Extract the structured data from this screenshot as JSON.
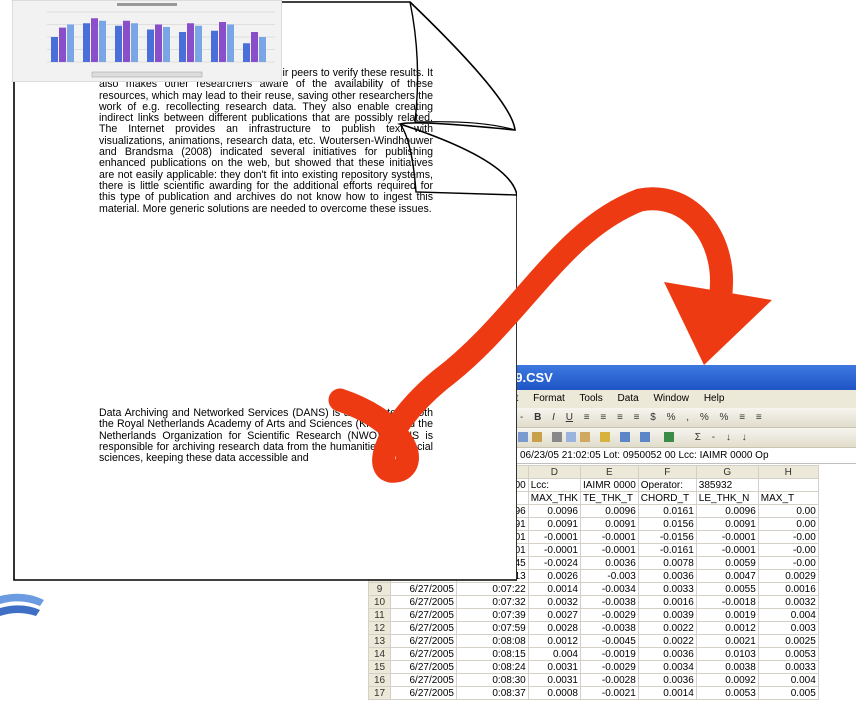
{
  "document": {
    "paragraph1": "demonstrate their results and helps their peers to verify these results. It also makes other researchers aware of the availability of these resources, which may lead to their reuse, saving other researchers the work of e.g. recollecting research data. They also enable creating indirect links between different publications that are possibly related. The Internet provides an infrastructure to publish text with visualizations, animations, research data, etc. Woutersen-Windhouwer and Brandsma (2008) indicated several initiatives for publishing enhanced publications on the web, but showed that these initiatives are not easily applicable: they don't fit into existing repository systems, there is little scientific awarding for the additional efforts required for this type of publication and archives do not know how to ingest this material. More generic solutions are needed to overcome these issues.",
    "paragraph2": "Data Archiving and Networked Services (DANS) is an institute of both the Royal Netherlands Academy of Arts and Sciences (KNAW) and the Netherlands Organization for Scientific Research (NWO). DANS is responsible for archiving research data from the humanities and social sciences, keeping these data accessible and"
  },
  "embedded_chart": {
    "type": "bar",
    "series_colors": [
      "#4a6fd8",
      "#8a4fc8",
      "#7aa6e8"
    ],
    "values": [
      [
        40,
        62,
        58,
        52,
        48,
        50,
        30
      ],
      [
        55,
        70,
        66,
        60,
        62,
        64,
        48
      ],
      [
        60,
        66,
        62,
        56,
        58,
        60,
        40
      ]
    ],
    "ymax": 80
  },
  "spreadsheet": {
    "title": "09.CSV",
    "menu": [
      "et",
      "Format",
      "Tools",
      "Data",
      "Window",
      "Help"
    ],
    "toolbar1": [
      "-",
      "B",
      "I",
      "U",
      "≡",
      "≡",
      "≡",
      "≡",
      "$",
      "%",
      ",",
      "%",
      "%",
      "≡",
      "≡"
    ],
    "toolbar2": [
      "Σ",
      "-",
      "↓",
      "↓"
    ],
    "formula_bar": "06/23/05   21:02:05   Lot: 0950052 00  Lcc: IAIMR 0000  Op",
    "col_headers": [
      "",
      "",
      "C",
      "D",
      "E",
      "F",
      "G",
      "H"
    ],
    "header_row1": [
      "",
      "",
      "ot: 0950052 00",
      "Lcc:",
      "IAIMR 0000",
      "Operator:",
      "385932",
      ""
    ],
    "header_row2": [
      "",
      "",
      "LE_THK_T",
      "MAX_THK",
      "TE_THK_T",
      "CHORD_T",
      "LE_THK_N",
      "MAX_T"
    ],
    "rows": [
      [
        "",
        "",
        "0.0096",
        "0.0096",
        "0.0096",
        "0.0161",
        "0.0096",
        "0.00"
      ],
      [
        "",
        "",
        "0.0091",
        "0.0091",
        "0.0091",
        "0.0156",
        "0.0091",
        "0.00"
      ],
      [
        "",
        "",
        "-0.0001",
        "-0.0001",
        "-0.0001",
        "-0.0156",
        "-0.0001",
        "-0.00"
      ],
      [
        "",
        "",
        "-0.0001",
        "-0.0001",
        "-0.0001",
        "-0.0161",
        "-0.0001",
        "-0.00"
      ],
      [
        "",
        "",
        "0.0045",
        "-0.0024",
        "0.0036",
        "0.0078",
        "0.0059",
        "-0.00"
      ],
      [
        "8",
        "6/27/2005",
        "0:07:13",
        "0.0026",
        "-0.003",
        "0.0036",
        "0.0047",
        "0.0029"
      ],
      [
        "9",
        "6/27/2005",
        "0:07:22",
        "0.0014",
        "-0.0034",
        "0.0033",
        "0.0055",
        "0.0016"
      ],
      [
        "10",
        "6/27/2005",
        "0:07:32",
        "0.0032",
        "-0.0038",
        "0.0016",
        "-0.0018",
        "0.0032"
      ],
      [
        "11",
        "6/27/2005",
        "0:07:39",
        "0.0027",
        "-0.0029",
        "0.0039",
        "0.0019",
        "0.004"
      ],
      [
        "12",
        "6/27/2005",
        "0:07:59",
        "0.0028",
        "-0.0038",
        "0.0022",
        "0.0012",
        "0.003"
      ],
      [
        "13",
        "6/27/2005",
        "0:08:08",
        "0.0012",
        "-0.0045",
        "0.0022",
        "0.0021",
        "0.0025"
      ],
      [
        "14",
        "6/27/2005",
        "0:08:15",
        "0.004",
        "-0.0019",
        "0.0036",
        "0.0103",
        "0.0053"
      ],
      [
        "15",
        "6/27/2005",
        "0:08:24",
        "0.0031",
        "-0.0029",
        "0.0034",
        "0.0038",
        "0.0033"
      ],
      [
        "16",
        "6/27/2005",
        "0:08:30",
        "0.0031",
        "-0.0028",
        "0.0036",
        "0.0092",
        "0.004"
      ],
      [
        "17",
        "6/27/2005",
        "0:08:37",
        "0.0008",
        "-0.0021",
        "0.0014",
        "0.0053",
        "0.005"
      ]
    ],
    "last_col": [
      "-0.00",
      "-0.00",
      "-0.00",
      "-0.00",
      "-0.00",
      "-0.00",
      "-0.00",
      "-0.00",
      "-0.00",
      "-0.0"
    ]
  },
  "colors": {
    "arrow": "#ee3a12",
    "titlebar": "#1f55c6",
    "logo": "#4a7fd0"
  }
}
